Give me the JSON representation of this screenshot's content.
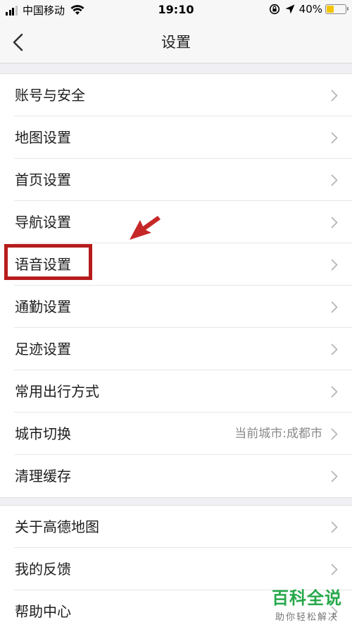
{
  "status_bar": {
    "carrier": "中国移动",
    "time": "19:10",
    "battery_percent": "40%",
    "battery_level": 0.4,
    "battery_color": "#f4c300"
  },
  "nav": {
    "title": "设置",
    "back_icon": "chevron-left-icon"
  },
  "group1": [
    {
      "label": "账号与安全"
    },
    {
      "label": "地图设置"
    },
    {
      "label": "首页设置"
    },
    {
      "label": "导航设置"
    },
    {
      "label": "语音设置",
      "highlighted": true
    },
    {
      "label": "通勤设置"
    },
    {
      "label": "足迹设置"
    },
    {
      "label": "常用出行方式"
    },
    {
      "label": "城市切换",
      "value": "当前城市:成都市"
    },
    {
      "label": "清理缓存"
    }
  ],
  "group2": [
    {
      "label": "关于高德地图"
    },
    {
      "label": "我的反馈"
    },
    {
      "label": "帮助中心"
    }
  ],
  "annotation": {
    "highlight_color": "#b71c1c",
    "arrow_color": "#c62828"
  },
  "watermark": {
    "logo": "百科全说",
    "tagline": "助你轻松解决"
  }
}
